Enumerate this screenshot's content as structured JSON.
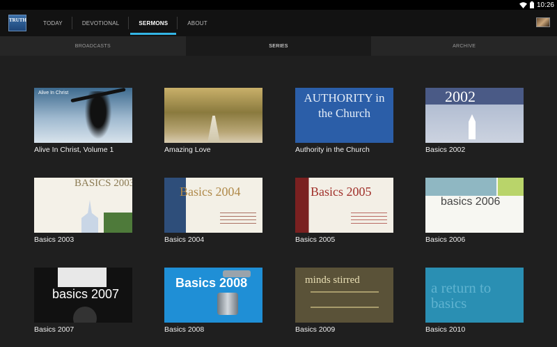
{
  "status_bar": {
    "time": "10:26"
  },
  "app": {
    "logo_text": "TRUTH"
  },
  "tabs": [
    {
      "label": "TODAY"
    },
    {
      "label": "DEVOTIONAL"
    },
    {
      "label": "SERMONS"
    },
    {
      "label": "ABOUT"
    }
  ],
  "subtabs": [
    {
      "label": "BROADCASTS"
    },
    {
      "label": "SERIES"
    },
    {
      "label": "ARCHIVE"
    }
  ],
  "series": [
    {
      "title": "Alive In Christ, Volume 1",
      "thumb_text": "Alive In Christ"
    },
    {
      "title": "Amazing Love",
      "thumb_text": ""
    },
    {
      "title": "Authority in the Church",
      "thumb_text": "AUTHORITY in the Church"
    },
    {
      "title": "Basics 2002",
      "thumb_text": "2002"
    },
    {
      "title": "Basics 2003",
      "thumb_text": "BASICS 2003"
    },
    {
      "title": "Basics 2004",
      "thumb_text": "Basics 2004"
    },
    {
      "title": "Basics 2005",
      "thumb_text": "Basics 2005"
    },
    {
      "title": "Basics 2006",
      "thumb_text": "basics 2006"
    },
    {
      "title": "Basics 2007",
      "thumb_text": "basics 2007"
    },
    {
      "title": "Basics 2008",
      "thumb_text": "Basics 2008"
    },
    {
      "title": "Basics 2009",
      "thumb_text": "minds stirred"
    },
    {
      "title": "Basics 2010",
      "thumb_text": "a return to basics"
    }
  ]
}
